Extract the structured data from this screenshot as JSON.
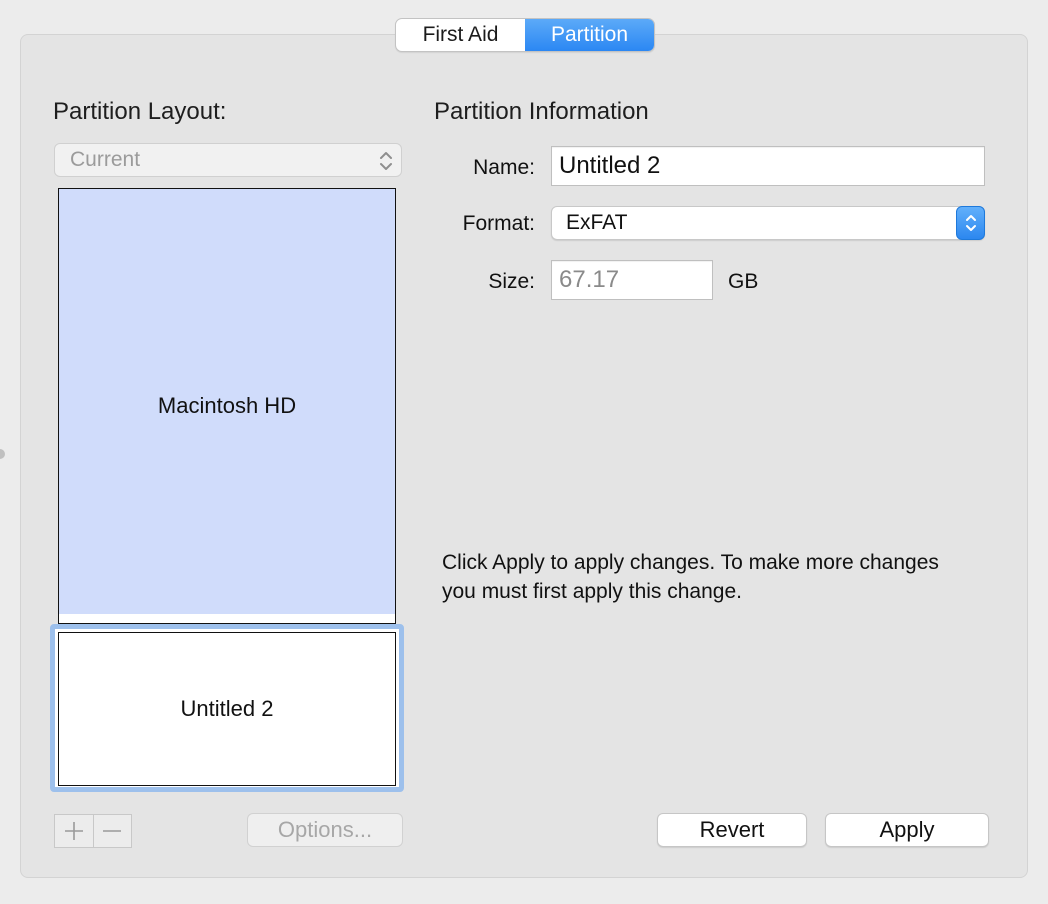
{
  "tabs": {
    "first_aid": "First Aid",
    "partition": "Partition",
    "selected": "Partition"
  },
  "left": {
    "title": "Partition Layout:",
    "layout_value": "Current",
    "partitions": {
      "macintosh_hd": "Macintosh HD",
      "untitled_2": "Untitled 2"
    },
    "options_label": "Options..."
  },
  "right": {
    "title": "Partition Information",
    "name_label": "Name:",
    "name_value": "Untitled 2",
    "format_label": "Format:",
    "format_value": "ExFAT",
    "size_label": "Size:",
    "size_value": "67.17",
    "size_unit": "GB",
    "message": "Click Apply to apply changes. To make more changes you must first apply this change."
  },
  "buttons": {
    "revert": "Revert",
    "apply": "Apply"
  },
  "colors": {
    "window_background": "#ececec",
    "panel_background": "#e4e4e4",
    "accent_blue": "#2b87f3",
    "macintosh_partition": "#d0dcfb",
    "selected_partition_outline": "#9dc0ec"
  },
  "icons": {
    "layout_chevron": "up-down-chevron-icon",
    "format_chevron": "up-down-chevron-icon",
    "add": "plus-icon",
    "remove": "minus-icon"
  }
}
